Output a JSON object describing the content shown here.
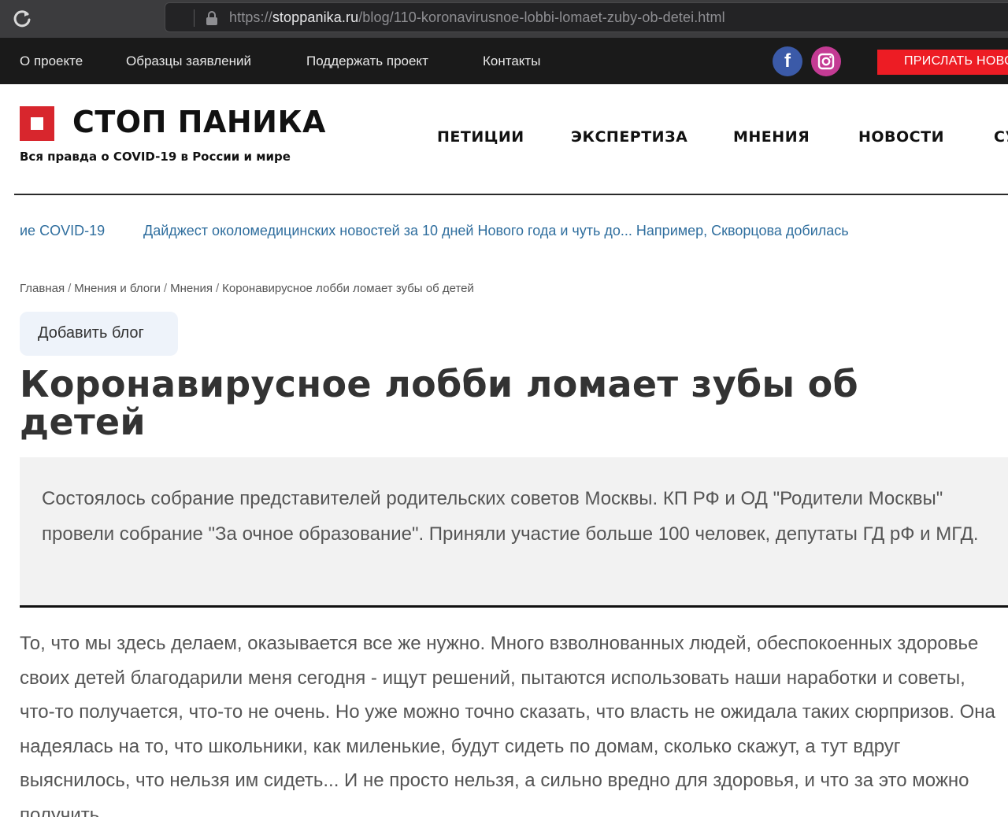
{
  "browser": {
    "url_scheme": "https://",
    "url_host": "stoppanika.ru",
    "url_path": "/blog/110-koronavirusnoe-lobbi-lomaet-zuby-ob-detei.html"
  },
  "topnav": {
    "links": [
      "О проекте",
      "Образцы заявлений",
      "Поддержать проект",
      "Контакты"
    ],
    "social": {
      "facebook_glyph": "f",
      "instagram_icon": "instagram-icon"
    },
    "send_news_label": "ПРИСЛАТЬ НОВОСТЬ"
  },
  "header": {
    "logo_title": "СТОП ПАНИКА",
    "tagline": "Вся правда о COVID-19 в России и мире",
    "nav": [
      "ПЕТИЦИИ",
      "ЭКСПЕРТИЗА",
      "МНЕНИЯ",
      "НОВОСТИ",
      "СУДЫ"
    ]
  },
  "ticker": {
    "items": [
      "ие COVID-19",
      "Дайджест околомедицинских новостей за 10 дней Нового года и чуть до... Например, Скворцова добилась"
    ]
  },
  "breadcrumb": {
    "items": [
      "Главная",
      "Мнения и блоги",
      "Мнения",
      "Коронавирусное лобби ломает зубы об детей"
    ],
    "separator": "/"
  },
  "add_blog_label": "Добавить блог",
  "article": {
    "title": "Коронавирусное лобби ломает зубы об детей",
    "lead": "Состоялось собрание представителей родительских советов Москвы. КП РФ и ОД \"Родители Москвы\" провели собрание \"За очное образование\". Приняли участие больше 100 человек, депутаты ГД рФ и МГД.",
    "body": "То, что мы здесь делаем, оказывается все же нужно. Много взволнованных людей, обеспокоенных здоровье своих детей благодарили меня сегодня - ищут решений, пытаются использовать наши наработки и советы, что-то получается, что-то не очень. Но уже можно точно сказать, что власть не ожидала таких сюрпризов. Она надеялась на то, что школьники, как миленькие, будут сидеть по домам, сколько скажут, а тут вдруг выяснилось, что нельзя им сидеть... И не просто нельзя, а сильно вредно для здоровья, и что за это можно получить"
  },
  "colors": {
    "topnav_bg": "#1a1a1a",
    "brand_red": "#d8262d",
    "send_news_red": "#ed1c24",
    "link_blue": "#2f6e9e",
    "facebook": "#3b5aa8",
    "instagram": "#c43b94"
  }
}
